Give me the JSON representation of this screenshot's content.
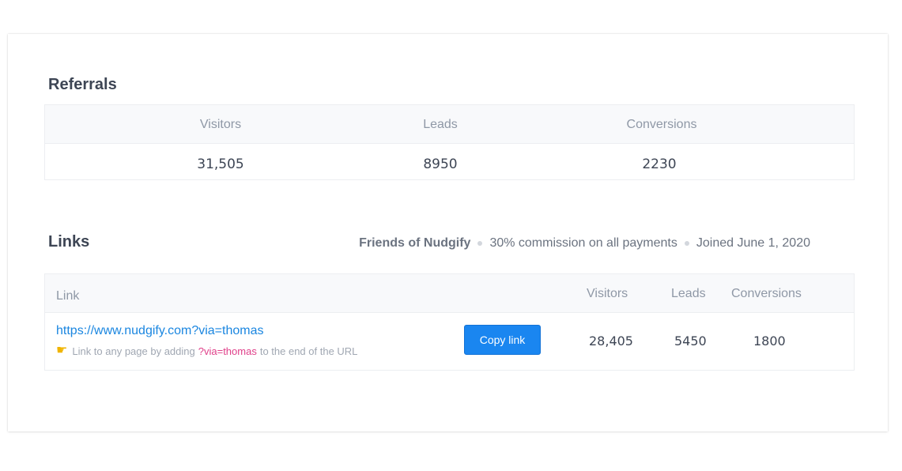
{
  "referrals": {
    "title": "Referrals",
    "headers": [
      "Visitors",
      "Leads",
      "Conversions"
    ],
    "values": [
      "31,505",
      "8950",
      "2230"
    ]
  },
  "links": {
    "title": "Links",
    "program_name": "Friends of Nudgify",
    "commission": "30% commission on all payments",
    "joined": "Joined June 1, 2020",
    "headers": {
      "link": "Link",
      "visitors": "Visitors",
      "leads": "Leads",
      "conversions": "Conversions"
    },
    "row": {
      "url": "https://www.nudgify.com?via=thomas",
      "hint_prefix": "Link to any page by adding",
      "hint_param": "?via=thomas",
      "hint_suffix": "to the end of the URL",
      "hint_icon": "pointing-hand-icon",
      "copy_label": "Copy link",
      "visitors": "28,405",
      "leads": "5450",
      "conversions": "1800"
    }
  },
  "colors": {
    "link": "#1a86e0",
    "button": "#1a86f0",
    "param": "#e0408a"
  }
}
